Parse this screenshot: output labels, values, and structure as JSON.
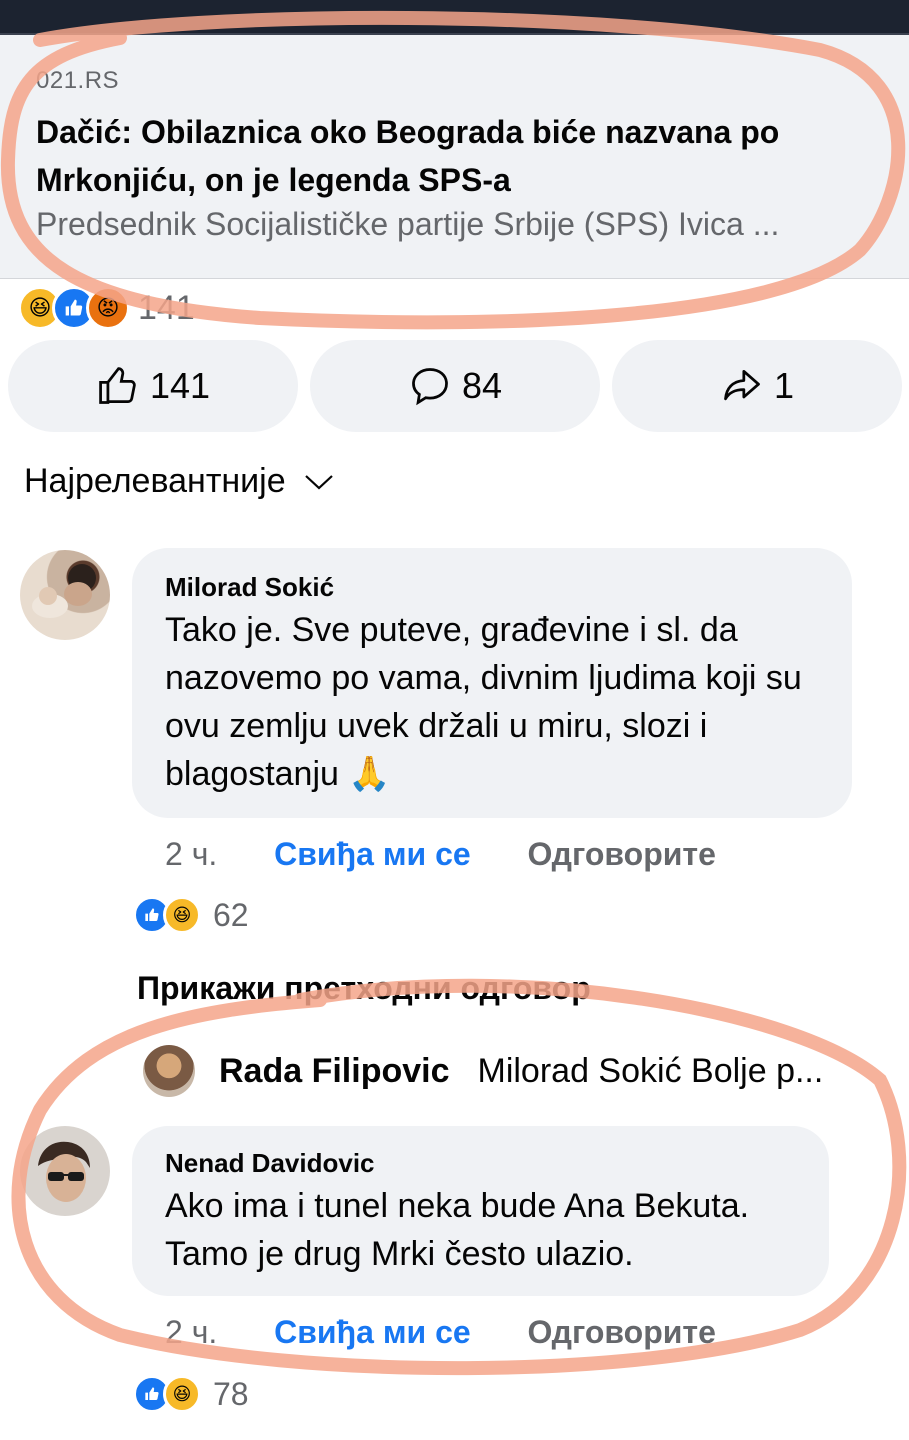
{
  "link": {
    "domain": "021.RS",
    "title": "Dačić: Obilaznica oko Beograda biće nazvana po Mrkonjiću, on je legenda SPS-a",
    "description": "Predsednik Socijalističke partije Srbije (SPS) Ivica ..."
  },
  "reactions": {
    "icons": [
      "haha-icon",
      "like-icon",
      "angry-icon"
    ],
    "count": "141"
  },
  "actions": {
    "like_count": "141",
    "comment_count": "84",
    "share_count": "1"
  },
  "sort": {
    "label": "Најрелевантније"
  },
  "comments": [
    {
      "author": "Milorad Sokić",
      "text": "Tako je. Sve puteve, građevine i sl. da nazovemo po vama, divnim ljudima koji su ovu zemlju uvek držali u miru, slozi i blagostanju 🙏",
      "time": "2 ч.",
      "like_label": "Свиђа ми се",
      "reply_label": "Одговорите",
      "reactions_count": "62"
    },
    {
      "author": "Nenad Davidovic",
      "text": "Ako ima i tunel neka bude Ana Bekuta. Tamo je drug Mrki često ulazio.",
      "time": "2 ч.",
      "like_label": "Свиђа ми се",
      "reply_label": "Одговорите",
      "reactions_count": "78"
    }
  ],
  "previous_replies_label": "Прикажи претходни одговор",
  "reply_preview": {
    "author": "Rada Filipovic",
    "text": "Milorad Sokić Bolje p..."
  },
  "colors": {
    "annotation": "#f4a58a",
    "link_blue": "#1877f2",
    "secondary_text": "#65676b",
    "bubble_bg": "#f0f2f5"
  }
}
